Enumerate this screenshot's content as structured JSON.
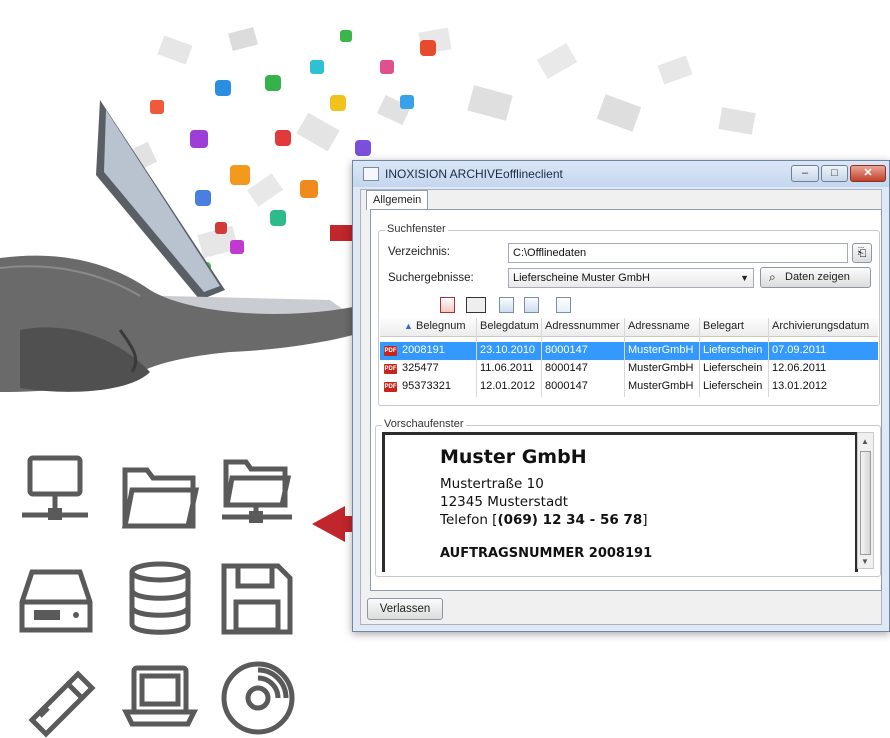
{
  "window": {
    "title": "INOXISION ARCHIVEofflineclient",
    "tab": "Allgemein",
    "controls": {
      "minimize": "–",
      "maximize": "□",
      "close": "✕"
    }
  },
  "search": {
    "group_label": "Suchfenster",
    "directory_label": "Verzeichnis:",
    "directory_value": "C:\\Offlinedaten",
    "results_label": "Suchergebnisse:",
    "results_selected": "Lieferscheine Muster GmbH",
    "show_button": "Daten zeigen"
  },
  "table": {
    "columns": [
      "Belegnum",
      "Belegdatum",
      "Adressnummer",
      "Adressname",
      "Belegart",
      "Archivierungsdatum"
    ],
    "rows": [
      {
        "belegnum": "2008191",
        "belegdatum": "23.10.2010",
        "adressnummer": "8000147",
        "adressname": "MusterGmbH",
        "belegart": "Lieferschein",
        "archivierungsdatum": "07.09.2011"
      },
      {
        "belegnum": "325477",
        "belegdatum": "11.06.2011",
        "adressnummer": "8000147",
        "adressname": "MusterGmbH",
        "belegart": "Lieferschein",
        "archivierungsdatum": "12.06.2011"
      },
      {
        "belegnum": "95373321",
        "belegdatum": "12.01.2012",
        "adressnummer": "8000147",
        "adressname": "MusterGmbH",
        "belegart": "Lieferschein",
        "archivierungsdatum": "13.01.2012"
      }
    ],
    "file_icon": "PDF"
  },
  "preview": {
    "group_label": "Vorschaufenster",
    "company": "Muster GmbH",
    "street": "Mustertraße 10",
    "city": "12345 Musterstadt",
    "phone_prefix": "Telefon [",
    "phone_number": "(069) 12 34 - 56 78",
    "phone_suffix": "]",
    "order": "AUFTRAGSNUMMER 2008191"
  },
  "footer": {
    "exit_button": "Verlassen"
  },
  "colors": {
    "selection": "#3399ff",
    "arrow": "#c0262b",
    "icon_gray": "#5a5a5a"
  },
  "illustration": {
    "devices": [
      "network-computer-icon",
      "folder-icon",
      "network-folder-icon",
      "hard-drive-icon",
      "database-icon",
      "floppy-disk-icon",
      "usb-stick-icon",
      "laptop-icon",
      "cd-icon"
    ]
  }
}
